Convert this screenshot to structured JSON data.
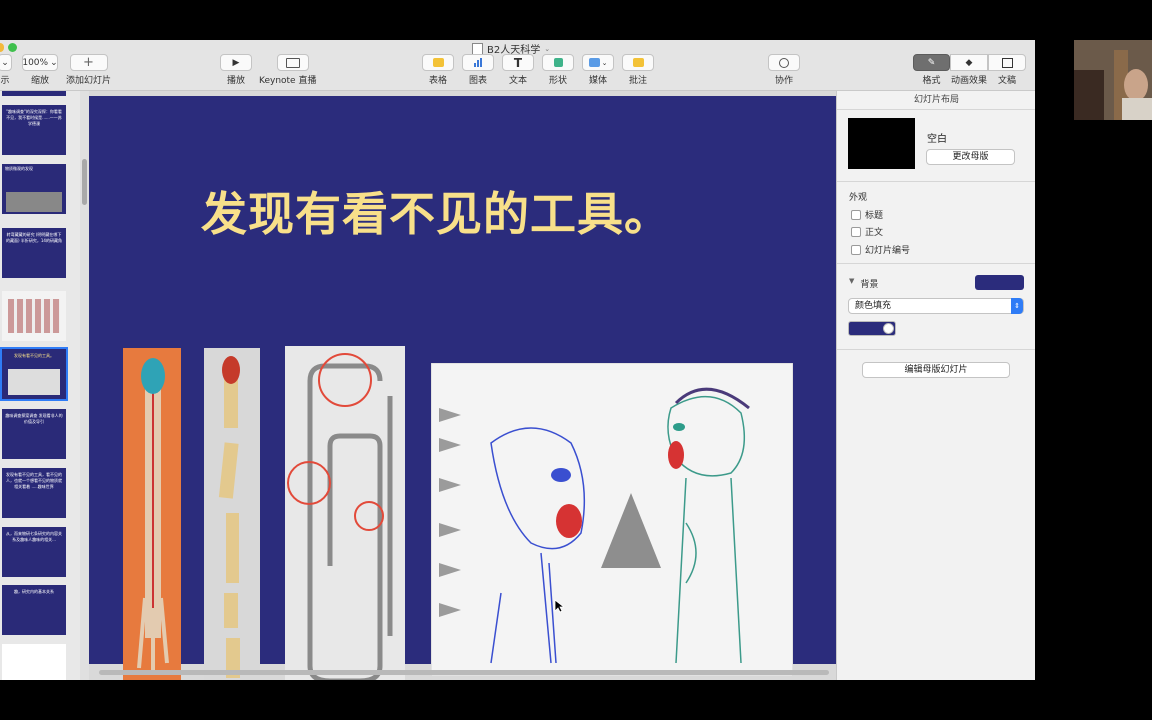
{
  "window": {
    "title": "B2人天科学"
  },
  "toolbar": {
    "view_label": "示",
    "zoom_value": "100%",
    "zoom_label": "缩放",
    "add_slide_label": "添加幻灯片",
    "play_label": "播放",
    "live_label": "Keynote 直播",
    "table_label": "表格",
    "chart_label": "图表",
    "text_label": "文本",
    "shape_label": "形状",
    "media_label": "媒体",
    "comment_label": "批注",
    "collab_label": "协作",
    "format_label": "格式",
    "animate_label": "动画效果",
    "document_label": "文稿"
  },
  "navigator": {
    "thumbnails": [
      {
        "text": ""
      },
      {
        "text": "\"趣味调查\"的深究深探：你看看不见，我不看时候是......一一苏学德漫"
      },
      {
        "text": "物质微观的发现"
      },
      {
        "text": "转弯藏藏的研究 (明明藏在哪下的藏面) 半折研究，14的研藏角"
      },
      {
        "text": ""
      },
      {
        "text": "发现有看不见的工具。"
      },
      {
        "text": "趣味调查探案调查 发现看非人的价值及导引"
      },
      {
        "text": "发现有看不见的工具，看不见的人，也就一个想看不见的物质就相关看着 .....趣味世界"
      },
      {
        "text": "从，而来物研七条研究的内容关系及趣味人趣味的相关..."
      },
      {
        "text": "趣，研究内的基本关系"
      },
      {
        "text": ""
      }
    ]
  },
  "slide": {
    "title": "发现有看不见的工具。"
  },
  "inspector": {
    "header": "幻灯片布局",
    "master_name": "空白",
    "change_master": "更改母版",
    "appearance": "外观",
    "opt_title": "标题",
    "opt_body": "正文",
    "opt_number": "幻灯片编号",
    "background": "背景",
    "fill_type": "颜色填充",
    "edit_master": "编辑母版幻灯片",
    "bg_color": "#2b2c7c"
  },
  "colors": {
    "accent": "#2f7cf6",
    "slide_bg": "#2b2c7c",
    "title": "#f8e08a",
    "annotation": "#e24a3a"
  }
}
